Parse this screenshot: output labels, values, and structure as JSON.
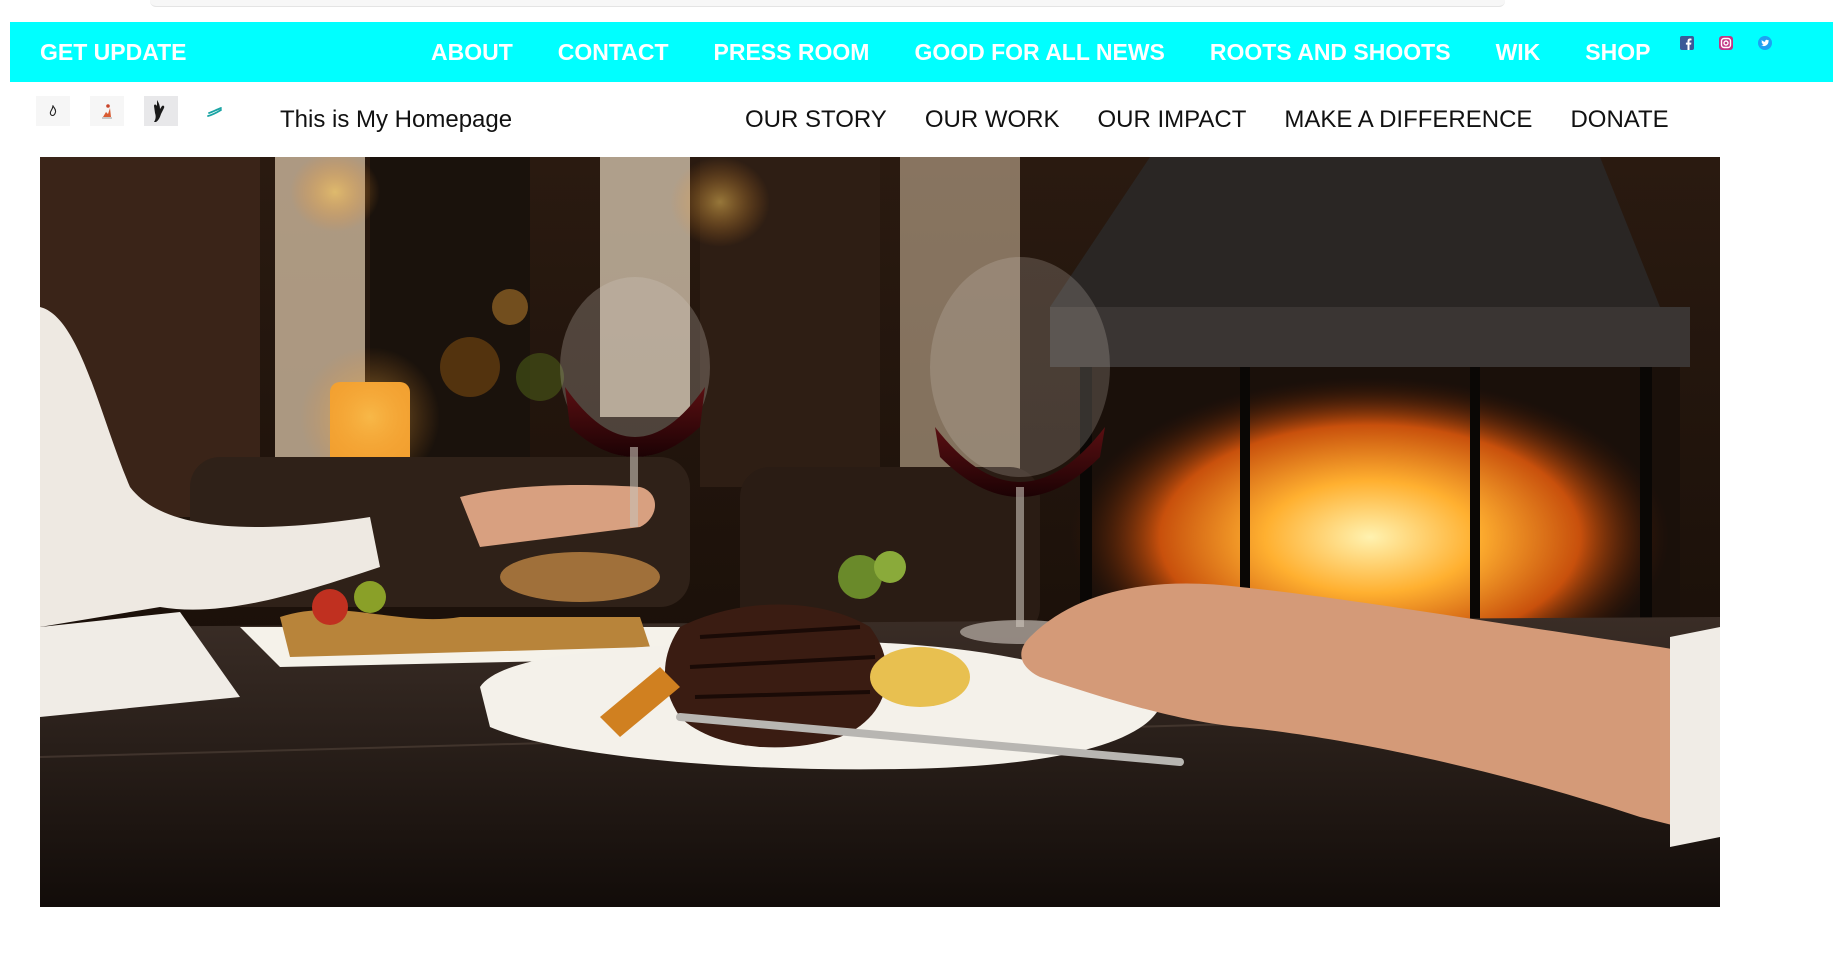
{
  "top_bar": {
    "get_update": "GET UPDATE",
    "nav": [
      "ABOUT",
      "CONTACT",
      "PRESS ROOM",
      "GOOD FOR ALL NEWS",
      "ROOTS AND SHOOTS",
      "WIK",
      "SHOP"
    ],
    "social_icons": [
      "facebook-icon",
      "instagram-icon",
      "twitter-icon"
    ],
    "accent_color": "#00ffff"
  },
  "sub_bar": {
    "thumbnails": [
      "flame-logo-icon",
      "figure-logo-icon",
      "hand-logo-icon",
      "swoosh-logo-icon"
    ],
    "title": "This is My Homepage",
    "nav": [
      "OUR STORY",
      "OUR WORK",
      "OUR IMPACT",
      "MAKE A DIFFERENCE",
      "DONATE"
    ]
  },
  "hero": {
    "image": "restaurant-dinner-photo"
  }
}
